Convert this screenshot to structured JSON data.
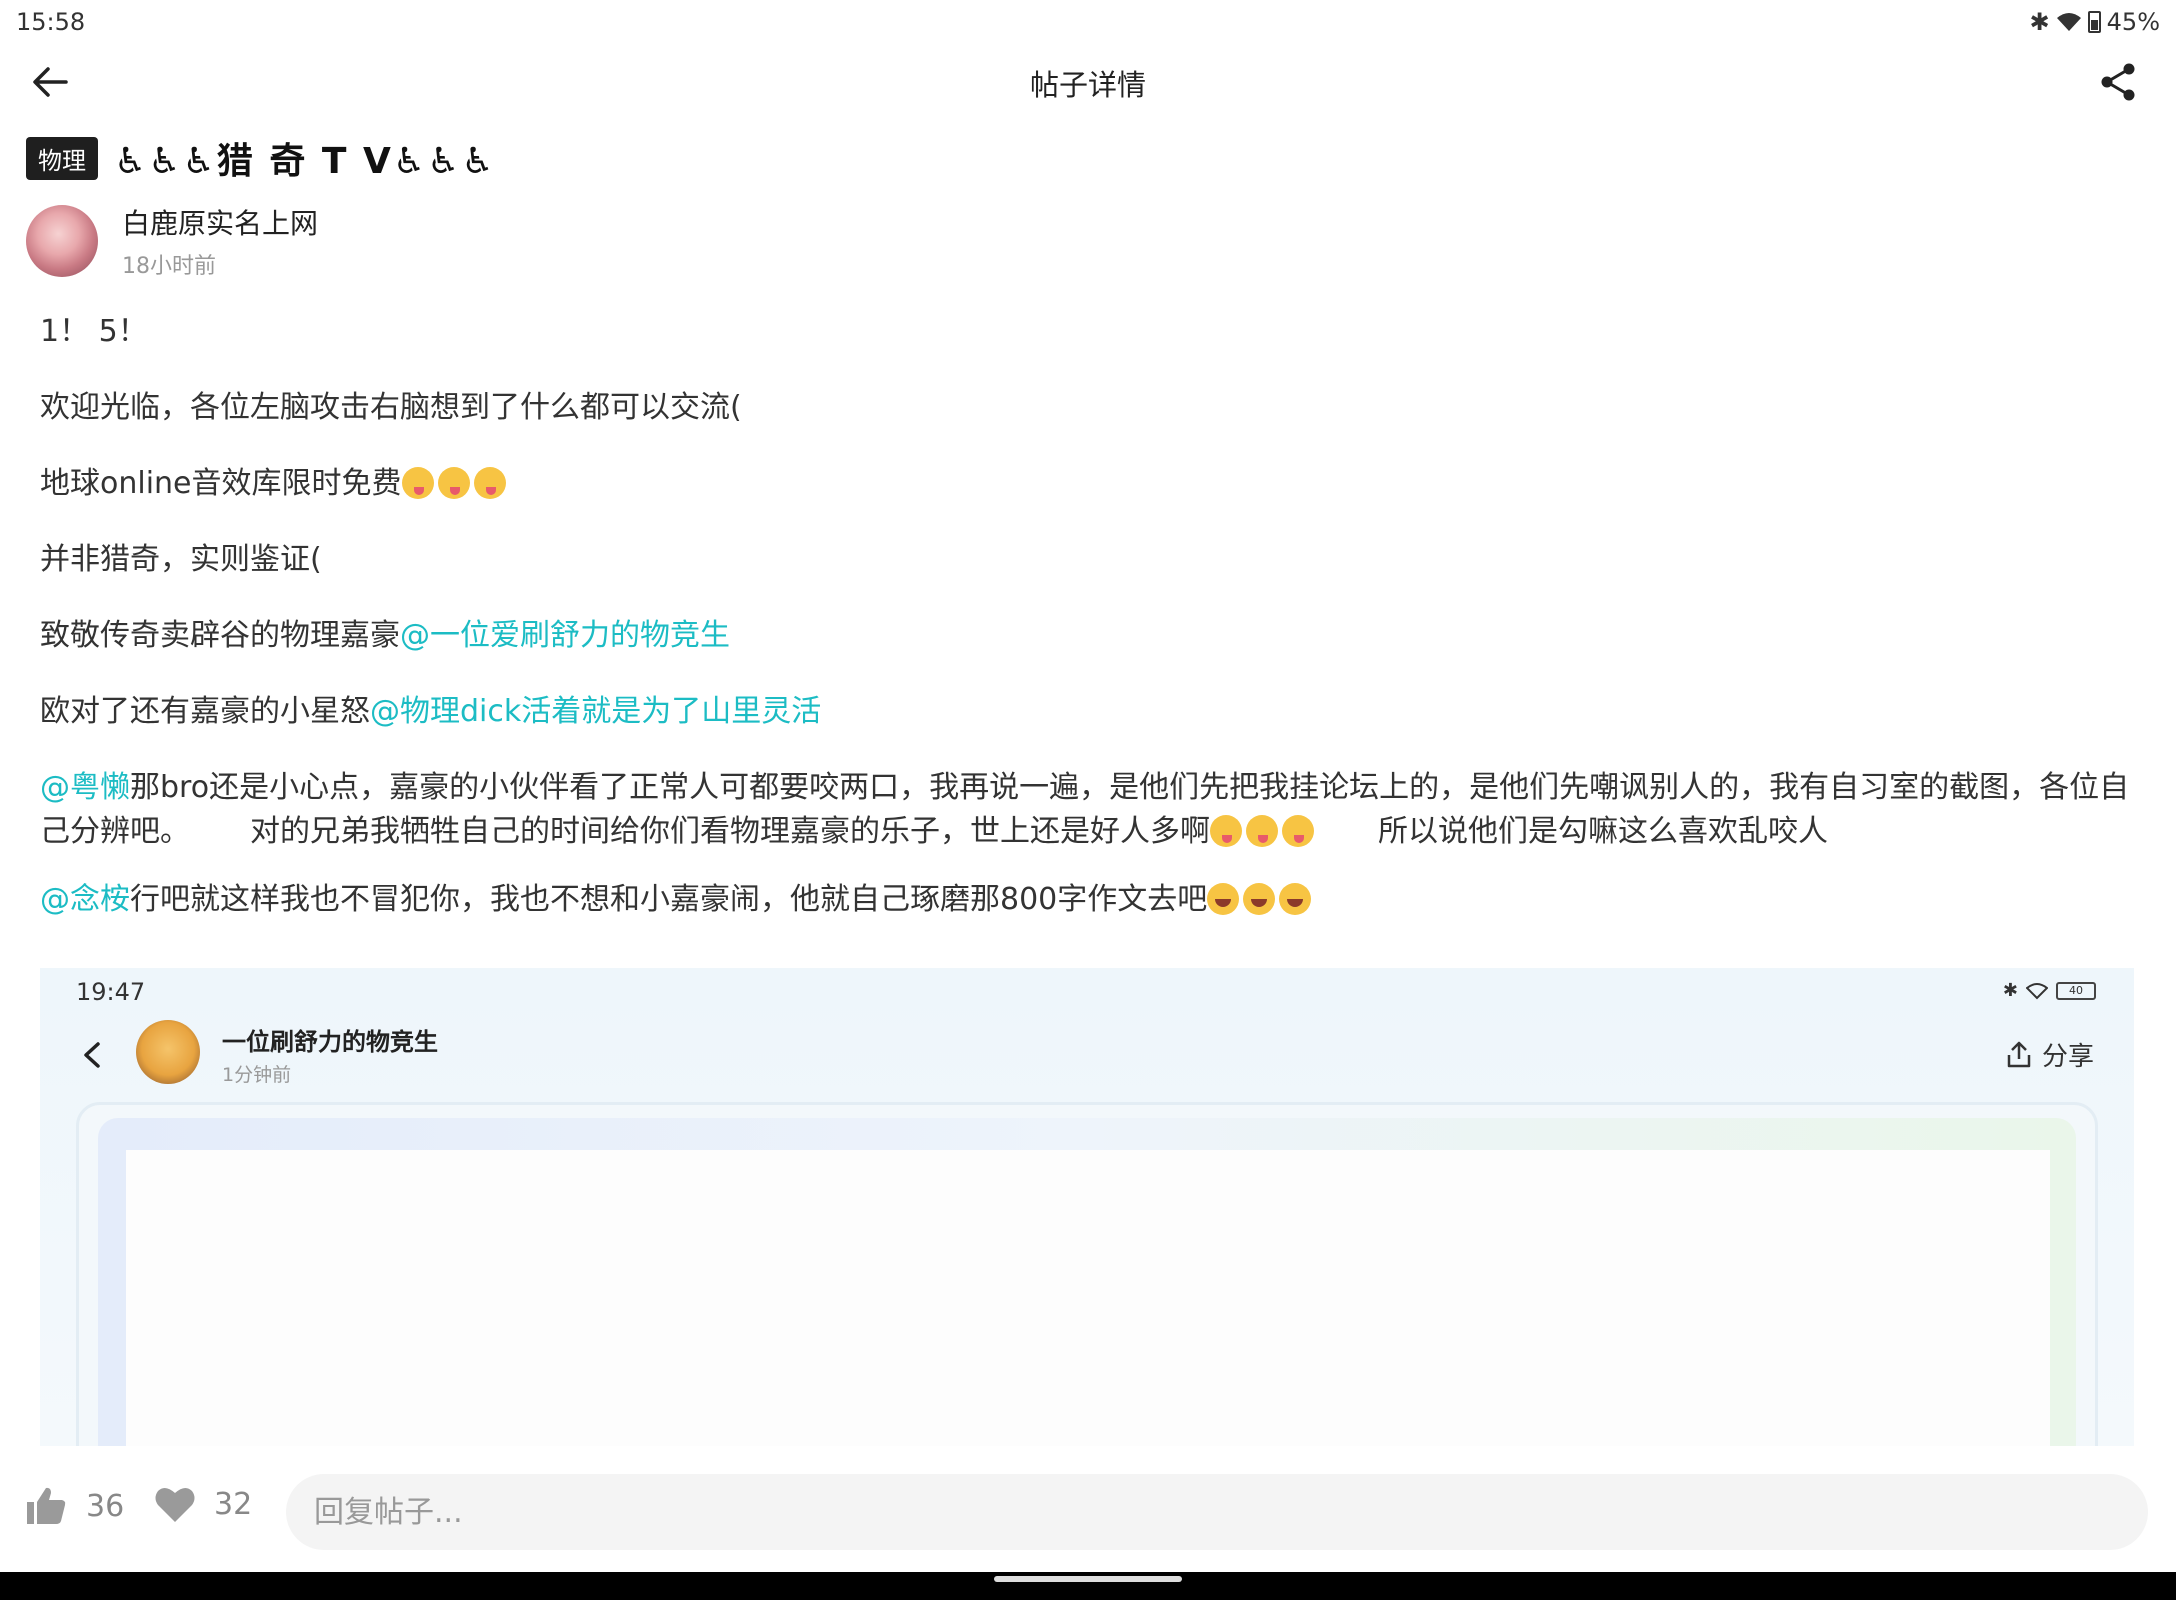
{
  "status_bar": {
    "time": "15:58",
    "battery": "45%"
  },
  "header": {
    "title": "帖子详情"
  },
  "post": {
    "tag": "物理",
    "title": "♿♿♿猎 奇 T V♿♿♿",
    "author": {
      "name": "白鹿原实名上网",
      "time": "18小时前"
    },
    "lines": {
      "l1": "1！ 5！",
      "l2": "欢迎光临，各位左脑攻击右脑想到了什么都可以交流(",
      "l3": "地球online音效库限时免费",
      "l4": "并非猎奇，实则鉴证(",
      "l5_text": "致敬传奇卖辟谷的物理嘉豪",
      "l5_mention": "@一位爱刷舒力的物竞生",
      "l6_text": "欧对了还有嘉豪的小星怒",
      "l6_mention": "@物理dick活着就是为了山里灵活",
      "l7_mention": "@粤懒",
      "l7_text_a": "那bro还是小心点，嘉豪的小伙伴看了正常人可都要咬两口，我再说一遍，是他们先把我挂论坛上的，是他们先嘲讽别人的，我有自习室的截图，各位自己分辨吧。",
      "l7_text_b": "对的兄弟我牺牲自己的时间给你们看物理嘉豪的乐子，世上还是好人多啊",
      "l7_text_c": "所以说他们是勾嘛这么喜欢乱咬人",
      "l8_mention": "@念桉",
      "l8_text": "行吧就这样我也不冒犯你，我也不想和小嘉豪闹，他就自己琢磨那800字作文去吧"
    }
  },
  "embed": {
    "time": "19:47",
    "battery": "40",
    "author_name": "一位刷舒力的物竞生",
    "author_time": "1分钟前",
    "share_label": "分享"
  },
  "bottom": {
    "like_count": "36",
    "fav_count": "32",
    "reply_placeholder": "回复帖子..."
  }
}
